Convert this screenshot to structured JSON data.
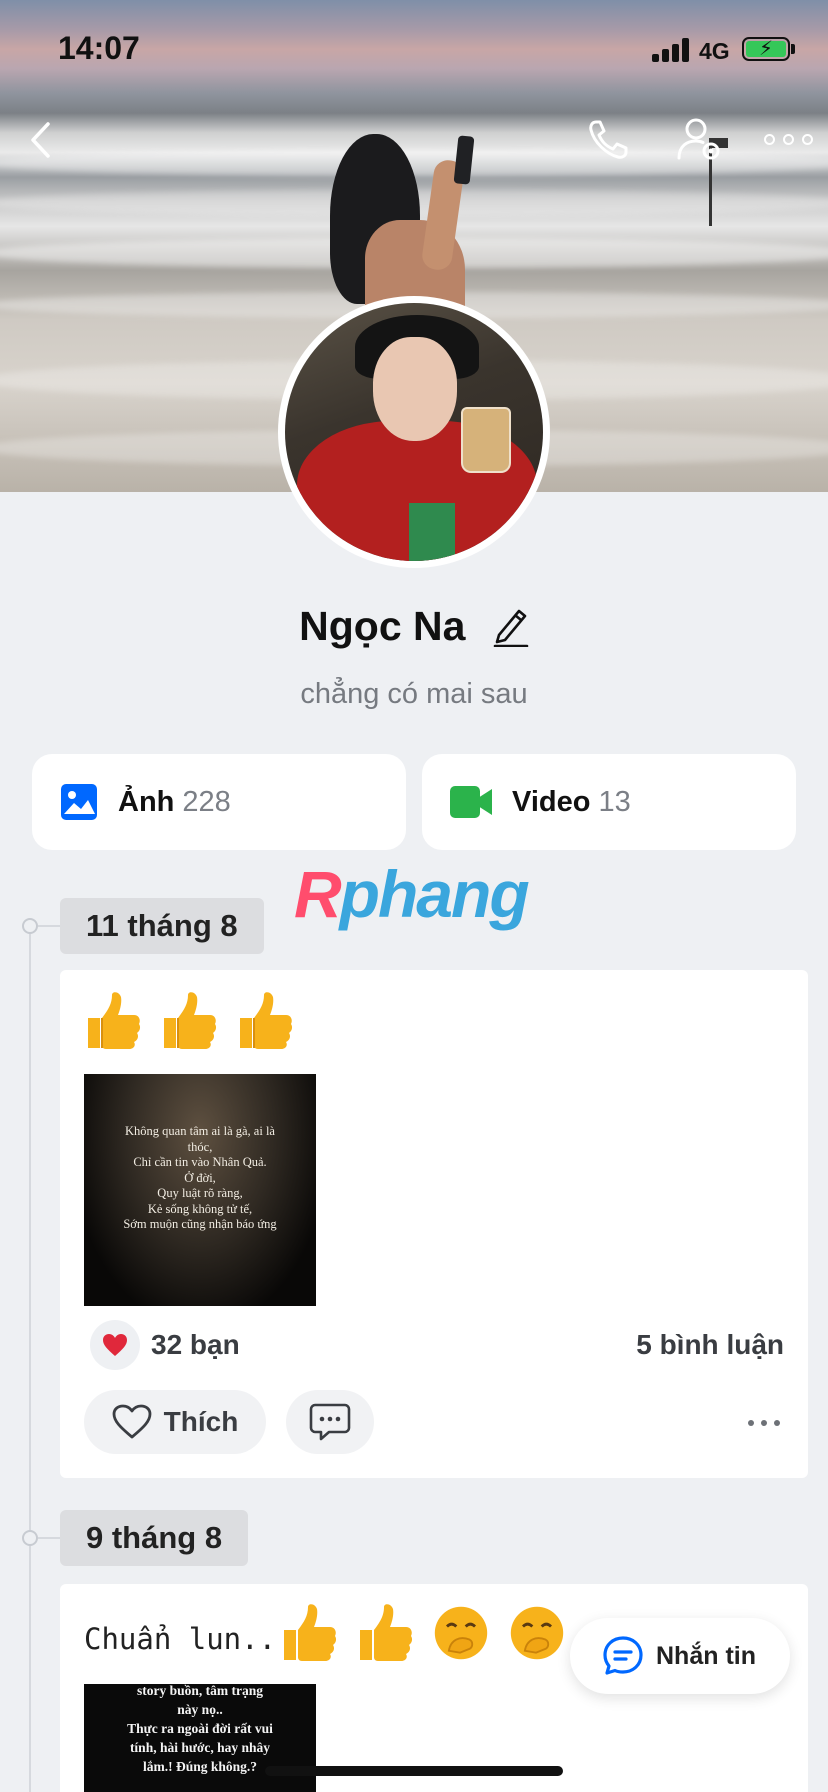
{
  "status_bar": {
    "time": "14:07",
    "network": "4G",
    "battery_level": 1.0,
    "battery_charging": true
  },
  "profile": {
    "name": "Ngọc Na",
    "bio": "chẳng có mai sau"
  },
  "media": {
    "photos_label": "Ảnh",
    "photos_count": "228",
    "videos_label": "Video",
    "videos_count": "13"
  },
  "watermark": {
    "first_letter": "R",
    "rest": "phang"
  },
  "timeline": [
    {
      "date": "11 tháng 8",
      "post": {
        "emojis": [
          "👍",
          "👍",
          "👍"
        ],
        "image_caption": [
          "Không quan tâm ai là gà, ai là",
          "thóc,",
          "Chỉ cần tin vào Nhân Quả.",
          "Ở đời,",
          "Quy luật rõ ràng,",
          "Kẻ sống không tử tế,",
          "Sớm muộn cũng nhận báo ứng"
        ],
        "reactions": "32 bạn",
        "comments": "5 bình luận",
        "like_label": "Thích"
      }
    },
    {
      "date": "9 tháng 8",
      "post": {
        "text": "Chuẩn lun..",
        "emojis": [
          "👍",
          "👍",
          "🤭",
          "🤭"
        ],
        "image_caption": [
          "story buồn, tâm trạng",
          "này nọ..",
          "Thực ra ngoài đời rất vui",
          "tính, hài hước, hay nhây",
          "lắm.! Đúng không.?"
        ]
      }
    }
  ],
  "message_button": {
    "label": "Nhắn tin"
  },
  "colors": {
    "accent": "#0068ff",
    "video_green": "#2bb34b",
    "heart_red": "#e0283b",
    "thumb_yellow": "#f7b21b",
    "battery_green": "#35c759",
    "watermark_red": "#ff4d6d",
    "watermark_blue": "#3aa6dd"
  }
}
